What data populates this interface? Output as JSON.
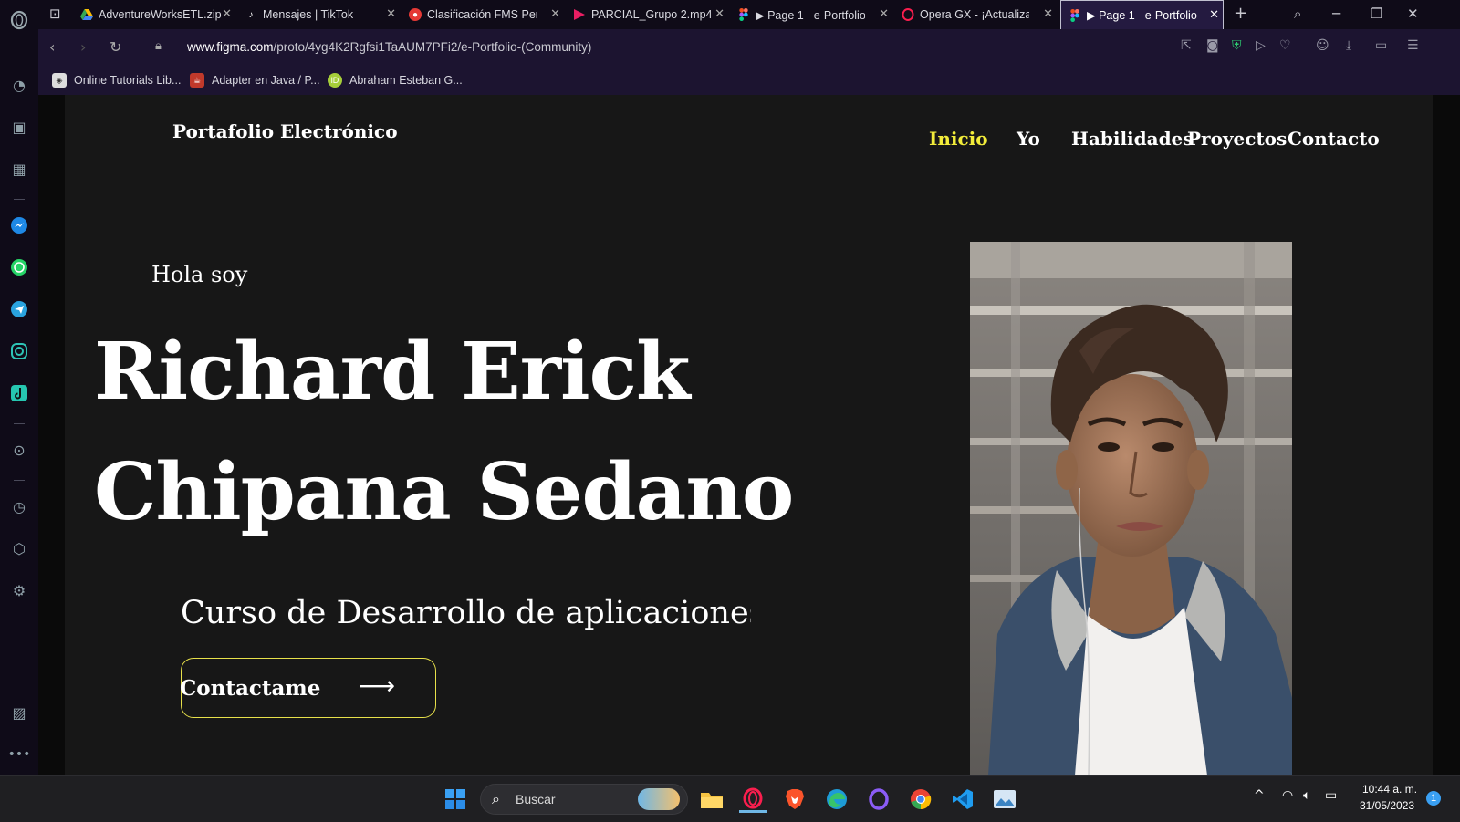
{
  "browser": {
    "tabs": [
      {
        "title": "AdventureWorksETL.zip",
        "favicon": "google-drive-icon",
        "color": "#f4b400"
      },
      {
        "title": "Mensajes | TikTok",
        "favicon": "tiktok-icon",
        "color": "#111111"
      },
      {
        "title": "Clasificación FMS Perú",
        "favicon": "fms-icon",
        "color": "#e53935"
      },
      {
        "title": "PARCIAL_Grupo 2.mp4",
        "favicon": "video-icon",
        "color": "#e91e63"
      },
      {
        "title": "▶ Page 1 - e-Portfolio",
        "favicon": "figma-icon",
        "color": "#a259ff"
      },
      {
        "title": "Opera GX - ¡Actualizaci",
        "favicon": "opera-gx-icon",
        "color": "#fa1e4e"
      },
      {
        "title": "▶ Page 1 - e-Portfolio",
        "favicon": "figma-icon",
        "color": "#a259ff",
        "active": true
      }
    ],
    "url_host": "www.figma.com",
    "url_path": "/proto/4yg4K2Rgfsi1TaAUM7PFi2/e-Portfolio-(Community)",
    "bookmarks": [
      {
        "title": "Online Tutorials Lib...",
        "icon": "tutorials-icon",
        "color": "#dddddd"
      },
      {
        "title": "Adapter en Java / P...",
        "icon": "java-icon",
        "color": "#c0392b"
      },
      {
        "title": "Abraham Esteban G...",
        "icon": "orcid-icon",
        "color": "#a6ce39"
      }
    ]
  },
  "site": {
    "brand": "Portafolio Electrónico",
    "nav": [
      "Inicio",
      "Yo",
      "Habilidades",
      "Proyectos",
      "Contacto"
    ],
    "active_nav": "Inicio",
    "accent_color": "#f2ec3a",
    "greeting": "Hola soy",
    "name_line1": "Richard Erick",
    "name_line2": "Chipana Sedano",
    "subtitle": "Curso de Desarrollo de aplicaciones w",
    "cta_label": "Contactame",
    "cta_icon": "arrow-right-icon"
  },
  "taskbar": {
    "search_placeholder": "Buscar",
    "apps": [
      "windows-start-icon",
      "file-explorer-icon",
      "opera-gx-icon",
      "brave-icon",
      "edge-icon",
      "opera-icon",
      "chrome-icon",
      "vscode-icon",
      "image-viewer-icon"
    ],
    "time": "10:44 a. m.",
    "date": "31/05/2023",
    "notification_count": "1"
  }
}
